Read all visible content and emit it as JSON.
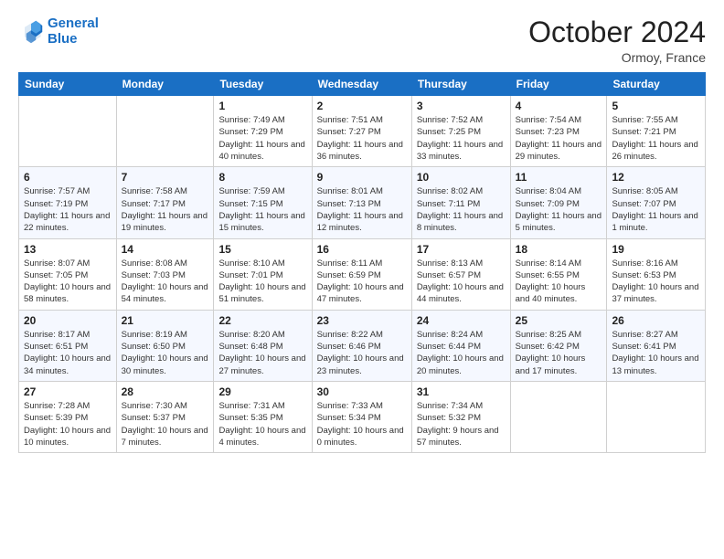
{
  "logo": {
    "line1": "General",
    "line2": "Blue"
  },
  "header": {
    "month": "October 2024",
    "location": "Ormoy, France"
  },
  "weekdays": [
    "Sunday",
    "Monday",
    "Tuesday",
    "Wednesday",
    "Thursday",
    "Friday",
    "Saturday"
  ],
  "weeks": [
    [
      {
        "day": "",
        "info": ""
      },
      {
        "day": "",
        "info": ""
      },
      {
        "day": "1",
        "info": "Sunrise: 7:49 AM\nSunset: 7:29 PM\nDaylight: 11 hours and 40 minutes."
      },
      {
        "day": "2",
        "info": "Sunrise: 7:51 AM\nSunset: 7:27 PM\nDaylight: 11 hours and 36 minutes."
      },
      {
        "day": "3",
        "info": "Sunrise: 7:52 AM\nSunset: 7:25 PM\nDaylight: 11 hours and 33 minutes."
      },
      {
        "day": "4",
        "info": "Sunrise: 7:54 AM\nSunset: 7:23 PM\nDaylight: 11 hours and 29 minutes."
      },
      {
        "day": "5",
        "info": "Sunrise: 7:55 AM\nSunset: 7:21 PM\nDaylight: 11 hours and 26 minutes."
      }
    ],
    [
      {
        "day": "6",
        "info": "Sunrise: 7:57 AM\nSunset: 7:19 PM\nDaylight: 11 hours and 22 minutes."
      },
      {
        "day": "7",
        "info": "Sunrise: 7:58 AM\nSunset: 7:17 PM\nDaylight: 11 hours and 19 minutes."
      },
      {
        "day": "8",
        "info": "Sunrise: 7:59 AM\nSunset: 7:15 PM\nDaylight: 11 hours and 15 minutes."
      },
      {
        "day": "9",
        "info": "Sunrise: 8:01 AM\nSunset: 7:13 PM\nDaylight: 11 hours and 12 minutes."
      },
      {
        "day": "10",
        "info": "Sunrise: 8:02 AM\nSunset: 7:11 PM\nDaylight: 11 hours and 8 minutes."
      },
      {
        "day": "11",
        "info": "Sunrise: 8:04 AM\nSunset: 7:09 PM\nDaylight: 11 hours and 5 minutes."
      },
      {
        "day": "12",
        "info": "Sunrise: 8:05 AM\nSunset: 7:07 PM\nDaylight: 11 hours and 1 minute."
      }
    ],
    [
      {
        "day": "13",
        "info": "Sunrise: 8:07 AM\nSunset: 7:05 PM\nDaylight: 10 hours and 58 minutes."
      },
      {
        "day": "14",
        "info": "Sunrise: 8:08 AM\nSunset: 7:03 PM\nDaylight: 10 hours and 54 minutes."
      },
      {
        "day": "15",
        "info": "Sunrise: 8:10 AM\nSunset: 7:01 PM\nDaylight: 10 hours and 51 minutes."
      },
      {
        "day": "16",
        "info": "Sunrise: 8:11 AM\nSunset: 6:59 PM\nDaylight: 10 hours and 47 minutes."
      },
      {
        "day": "17",
        "info": "Sunrise: 8:13 AM\nSunset: 6:57 PM\nDaylight: 10 hours and 44 minutes."
      },
      {
        "day": "18",
        "info": "Sunrise: 8:14 AM\nSunset: 6:55 PM\nDaylight: 10 hours and 40 minutes."
      },
      {
        "day": "19",
        "info": "Sunrise: 8:16 AM\nSunset: 6:53 PM\nDaylight: 10 hours and 37 minutes."
      }
    ],
    [
      {
        "day": "20",
        "info": "Sunrise: 8:17 AM\nSunset: 6:51 PM\nDaylight: 10 hours and 34 minutes."
      },
      {
        "day": "21",
        "info": "Sunrise: 8:19 AM\nSunset: 6:50 PM\nDaylight: 10 hours and 30 minutes."
      },
      {
        "day": "22",
        "info": "Sunrise: 8:20 AM\nSunset: 6:48 PM\nDaylight: 10 hours and 27 minutes."
      },
      {
        "day": "23",
        "info": "Sunrise: 8:22 AM\nSunset: 6:46 PM\nDaylight: 10 hours and 23 minutes."
      },
      {
        "day": "24",
        "info": "Sunrise: 8:24 AM\nSunset: 6:44 PM\nDaylight: 10 hours and 20 minutes."
      },
      {
        "day": "25",
        "info": "Sunrise: 8:25 AM\nSunset: 6:42 PM\nDaylight: 10 hours and 17 minutes."
      },
      {
        "day": "26",
        "info": "Sunrise: 8:27 AM\nSunset: 6:41 PM\nDaylight: 10 hours and 13 minutes."
      }
    ],
    [
      {
        "day": "27",
        "info": "Sunrise: 7:28 AM\nSunset: 5:39 PM\nDaylight: 10 hours and 10 minutes."
      },
      {
        "day": "28",
        "info": "Sunrise: 7:30 AM\nSunset: 5:37 PM\nDaylight: 10 hours and 7 minutes."
      },
      {
        "day": "29",
        "info": "Sunrise: 7:31 AM\nSunset: 5:35 PM\nDaylight: 10 hours and 4 minutes."
      },
      {
        "day": "30",
        "info": "Sunrise: 7:33 AM\nSunset: 5:34 PM\nDaylight: 10 hours and 0 minutes."
      },
      {
        "day": "31",
        "info": "Sunrise: 7:34 AM\nSunset: 5:32 PM\nDaylight: 9 hours and 57 minutes."
      },
      {
        "day": "",
        "info": ""
      },
      {
        "day": "",
        "info": ""
      }
    ]
  ]
}
